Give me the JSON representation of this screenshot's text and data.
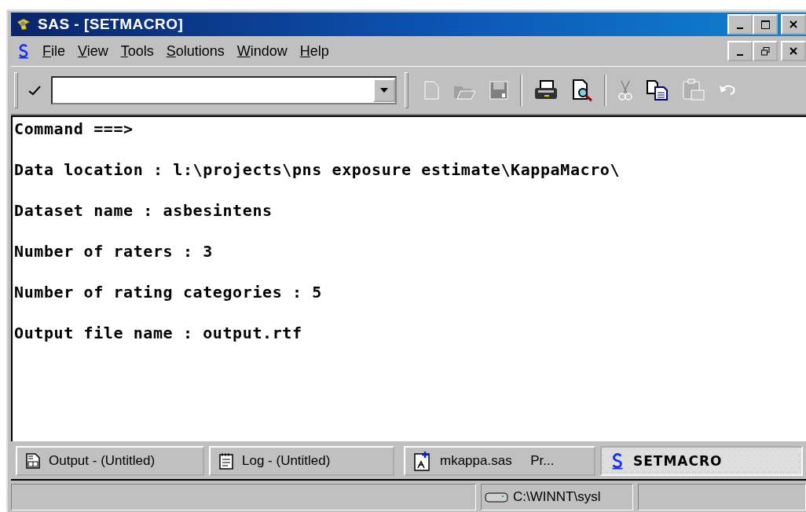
{
  "window": {
    "title": "SAS - [SETMACRO]"
  },
  "menu": [
    {
      "label": "File"
    },
    {
      "label": "View"
    },
    {
      "label": "Tools"
    },
    {
      "label": "Solutions"
    },
    {
      "label": "Window"
    },
    {
      "label": "Help"
    }
  ],
  "toolbar": [
    {
      "kind": "new",
      "disabled": true
    },
    {
      "kind": "open",
      "disabled": true
    },
    {
      "kind": "save",
      "disabled": true
    },
    {
      "kind": "sep"
    },
    {
      "kind": "print",
      "disabled": false
    },
    {
      "kind": "preview",
      "disabled": false
    },
    {
      "kind": "sep"
    },
    {
      "kind": "cut",
      "disabled": true
    },
    {
      "kind": "copy",
      "disabled": false
    },
    {
      "kind": "paste",
      "disabled": true
    },
    {
      "kind": "undo",
      "disabled": true
    }
  ],
  "lines": [
    "Command ===>",
    "Data location : l:\\projects\\pns exposure estimate\\KappaMacro\\",
    "Dataset name : asbesintens",
    "Number of raters : 3",
    "Number of rating categories : 5",
    "Output file name : output.rtf"
  ],
  "tabs": [
    {
      "label": "Output - (Untitled)",
      "kind": "output",
      "selected": false
    },
    {
      "label": "Log - (Untitled)",
      "kind": "log",
      "selected": false
    },
    {
      "label": "mkappa.sas     Pr...",
      "kind": "program",
      "selected": false
    },
    {
      "label": "SETMACRO",
      "kind": "sas",
      "selected": true
    }
  ],
  "status_bar": {
    "path": "C:\\WINNT\\sysl"
  }
}
